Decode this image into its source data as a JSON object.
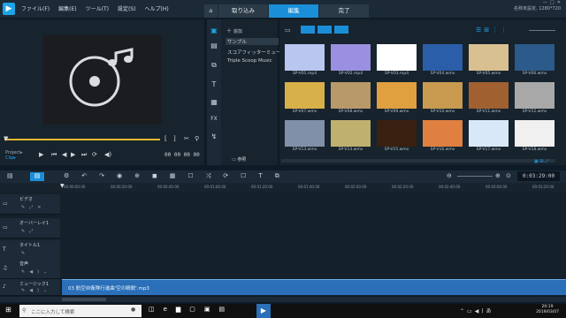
{
  "app": {
    "menu": [
      "ファイル(F)",
      "編集(E)",
      "ツール(T)",
      "設定(S)",
      "ヘルプ(H)"
    ],
    "mode_tabs": [
      "取り込み",
      "編集",
      "完了"
    ],
    "active_mode": "編集",
    "window_info_line1": "名称未設定, 1280*720",
    "window_info_line2": ""
  },
  "preview": {
    "project_label": "Project▸",
    "clip_label": "Clip▸",
    "timecode": "00:00:00:00",
    "timecode_alt": "00 00 00 00"
  },
  "library": {
    "add_label": "追加",
    "folders": [
      "サンプル",
      "スコアフィッターミュー...",
      "Triple Scoop Music"
    ],
    "browse_label": "参照",
    "thumbnails": [
      {
        "label": "SP-V01.mp4",
        "color": "#b8c6f0"
      },
      {
        "label": "SP-V02.mp4",
        "color": "#9a8fe0"
      },
      {
        "label": "SP-V03.mp4",
        "color": "#ffffff"
      },
      {
        "label": "SP-V04.wmv",
        "color": "#2b5ea8"
      },
      {
        "label": "SP-V05.wmv",
        "color": "#d8c090"
      },
      {
        "label": "SP-V06.wmv",
        "color": "#2c5a8a"
      },
      {
        "label": "SP-V07.wmv",
        "color": "#d8b04a"
      },
      {
        "label": "SP-V08.wmv",
        "color": "#b89a6a"
      },
      {
        "label": "SP-V09.wmv",
        "color": "#e0a040"
      },
      {
        "label": "SP-V10.wmv",
        "color": "#c89a50"
      },
      {
        "label": "SP-V11.wmv",
        "color": "#a06030"
      },
      {
        "label": "SP-V12.wmv",
        "color": "#a8a8a8"
      },
      {
        "label": "SP-V13.wmv",
        "color": "#8090a8"
      },
      {
        "label": "SP-V14.wmv",
        "color": "#c0b070"
      },
      {
        "label": "SP-V15.wmv",
        "color": "#3a2010"
      },
      {
        "label": "SP-V16.wmv",
        "color": "#e08040"
      },
      {
        "label": "SP-V17.wmv",
        "color": "#d8e8f8"
      },
      {
        "label": "SP-V18.wmv",
        "color": "#f0f0f0"
      }
    ]
  },
  "timeline": {
    "timecode": "0:03:29:00",
    "ruler": [
      "00:00:00:00",
      "00:00:20:00",
      "00:00:40:00",
      "00:01:00:00",
      "00:01:20:00",
      "00:01:40:00",
      "00:02:00:00",
      "00:02:20:00",
      "00:02:40:00",
      "00:03:00:00",
      "00:03:20:00"
    ],
    "tracks": [
      "ビデオ",
      "オーバーレイ1",
      "タイトル1",
      "音声",
      "ミュージック1"
    ],
    "music_clip": "03 航空自衛隊行進曲'空の精鋭'.mp3"
  },
  "taskbar": {
    "search_placeholder": "ここに入力して検索",
    "time": "20:19",
    "date": "2019/03/07"
  }
}
